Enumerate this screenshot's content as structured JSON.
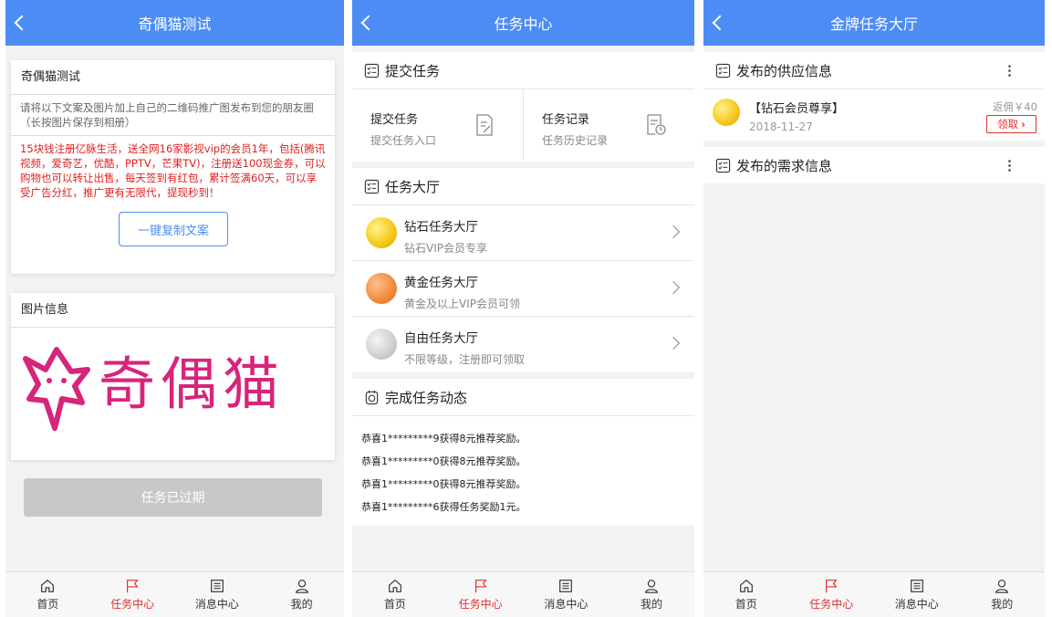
{
  "screen1": {
    "title": "奇偶猫测试",
    "card1_title": "奇偶猫测试",
    "card1_desc": "请将以下文案及图片加上自己的二维码推广图发布到您的朋友圈（长按图片保存到相册）",
    "card1_text": "15块钱注册亿脉生活，送全网16家影视vip的会员1年，包括(腾讯视频，爱奇艺，优酷，PPTV，芒果TV)，注册送100现金券，可以购物也可以转让出售，每天签到有红包，累计签满60天，可以享受广告分红，推广更有无限代，提现秒到！",
    "copy_button": "一键复制文案",
    "card2_title": "图片信息",
    "logo_text": "奇偶猫",
    "expired_button": "任务已过期"
  },
  "screen2": {
    "title": "任务中心",
    "submit_section": "提交任务",
    "submit_task": {
      "title": "提交任务",
      "desc": "提交任务入口"
    },
    "task_record": {
      "title": "任务记录",
      "desc": "任务历史记录"
    },
    "hall_section": "任务大厅",
    "halls": [
      {
        "title": "钻石任务大厅",
        "desc": "钻石VIP会员专享",
        "color": "#f5c518"
      },
      {
        "title": "黄金任务大厅",
        "desc": "黄金及以上VIP会员可领",
        "color": "#f08a3a"
      },
      {
        "title": "自由任务大厅",
        "desc": "不限等级，注册即可领取",
        "color": "#cfcfcf"
      }
    ],
    "feed_section": "完成任务动态",
    "feed": [
      "恭喜1*********9获得8元推荐奖励。",
      "恭喜1*********0获得8元推荐奖励。",
      "恭喜1*********0获得8元推荐奖励。",
      "恭喜1*********6获得任务奖励1元。"
    ]
  },
  "screen3": {
    "title": "金牌任务大厅",
    "supply_section": "发布的供应信息",
    "supply_item": {
      "title": "【钻石会员尊享】",
      "date": "2018-11-27",
      "rebate": "返佣￥40",
      "claim": "领取"
    },
    "demand_section": "发布的需求信息"
  },
  "tabbar": {
    "items": [
      "首页",
      "任务中心",
      "消息中心",
      "我的"
    ],
    "active_index": 1
  },
  "colors": {
    "primary": "#4d8cf5",
    "accent_red": "#e0302a",
    "brand_pink": "#d6257a"
  }
}
